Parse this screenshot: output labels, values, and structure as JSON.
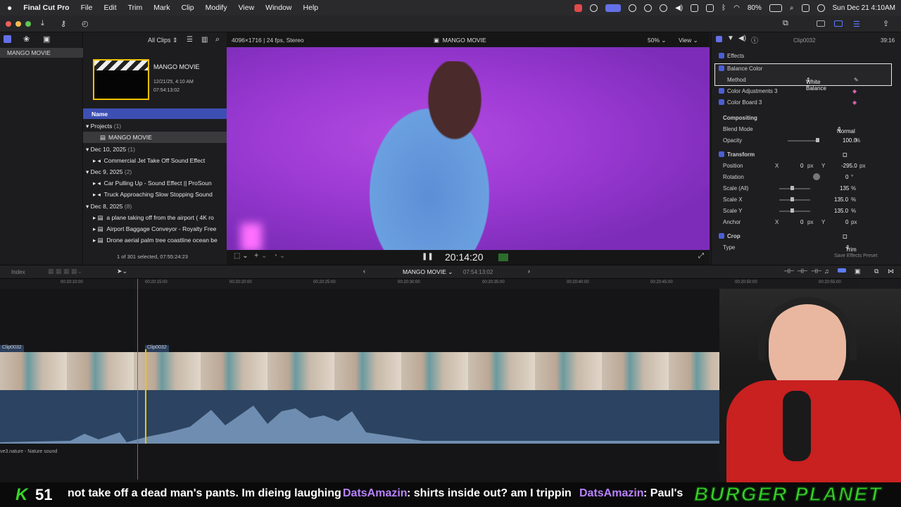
{
  "menubar": {
    "app": "Final Cut Pro",
    "items": [
      "File",
      "Edit",
      "Trim",
      "Mark",
      "Clip",
      "Modify",
      "View",
      "Window",
      "Help"
    ],
    "battery": "80%",
    "clock": "Sun Dec 21  4:10AM"
  },
  "browser": {
    "filter": "All Clips",
    "library": "MANGO MOVIE",
    "project_title": "MANGO MOVIE",
    "project_date": "12/21/25, 4:10 AM",
    "project_duration": "07:54:13:02",
    "column_name": "Name",
    "groups": [
      {
        "label": "Projects",
        "count": "(1)",
        "items": [
          "MANGO MOVIE"
        ]
      },
      {
        "label": "Dec 10, 2025",
        "count": "(1)",
        "items": [
          "Commercial Jet Take Off Sound Effect"
        ]
      },
      {
        "label": "Dec 9, 2025",
        "count": "(2)",
        "items": [
          "Car Pulling Up - Sound Effect  ||  ProSoun",
          "Truck Approaching Slow Stopping Sound"
        ]
      },
      {
        "label": "Dec 8, 2025",
        "count": "(8)",
        "items": [
          "a plane taking off from the airport ( 4K ro",
          "Airport Baggage Conveyor - Royalty Free",
          "Drone aerial palm tree coastline ocean be"
        ]
      }
    ],
    "status": "1 of 301 selected, 07:55:24:23"
  },
  "viewer": {
    "format": "4096×1716 | 24 fps, Stereo",
    "title": "MANGO MOVIE",
    "zoom": "50%",
    "view_label": "View",
    "timecode": "20:14:20"
  },
  "inspector": {
    "clip": "Clip0032",
    "duration": "39:16",
    "effects_header": "Effects",
    "balance_color": "Balance Color",
    "method_label": "Method",
    "method_value": "White Balance",
    "color_adjustments": "Color Adjustments 3",
    "color_board": "Color Board 3",
    "compositing": "Compositing",
    "blend_mode_label": "Blend Mode",
    "blend_mode_value": "Normal",
    "opacity_label": "Opacity",
    "opacity_value": "100.0",
    "opacity_unit": "%",
    "transform": "Transform",
    "position_label": "Position",
    "pos_x": "0",
    "pos_y": "-295.0",
    "px": "px",
    "rotation_label": "Rotation",
    "rotation_value": "0",
    "rotation_unit": "°",
    "scale_all_label": "Scale (All)",
    "scale_all_value": "135",
    "scale_x_label": "Scale X",
    "scale_x_value": "135.0",
    "scale_y_label": "Scale Y",
    "scale_y_value": "135.0",
    "anchor_label": "Anchor",
    "anchor_x": "0",
    "anchor_y": "0",
    "crop": "Crop",
    "type_label": "Type",
    "type_value": "Trim",
    "save_preset": "Save Effects Preset",
    "x": "X",
    "y": "Y"
  },
  "timeline": {
    "index": "Index",
    "project": "MANGO MOVIE",
    "duration": "07:54:13:02",
    "ruler": [
      "00:20:10:00",
      "00:20:15:00",
      "00:20:20:00",
      "00:20:25:00",
      "00:20:30:00",
      "00:20:35:00",
      "00:20:40:00",
      "00:20:45:00",
      "00:20:50:00",
      "00:20:55:00"
    ],
    "clip_a": "Clip0032",
    "clip_b": "Clip0032",
    "audio_label": "ve3.nature - Nature sound"
  },
  "ticker": {
    "count_k": "K",
    "count": "51",
    "msg1": "not take off a dead man's pants. Im dieing laughing",
    "user1": "DatsAmazin",
    "msg2": ": shirts inside out? am I trippin",
    "user2": "DatsAmazin",
    "msg3": ": Paul's",
    "brand": "BURGER PLANET"
  }
}
